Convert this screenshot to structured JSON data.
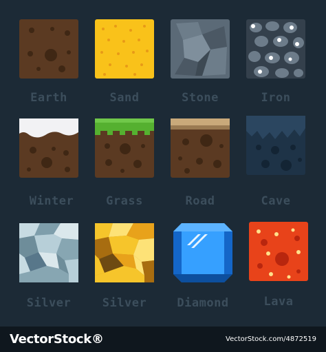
{
  "tiles": [
    {
      "label": "Earth"
    },
    {
      "label": "Sand"
    },
    {
      "label": "Stone"
    },
    {
      "label": "Iron"
    },
    {
      "label": "Winter"
    },
    {
      "label": "Grass"
    },
    {
      "label": "Road"
    },
    {
      "label": "Cave"
    },
    {
      "label": "Silver"
    },
    {
      "label": "Silver"
    },
    {
      "label": "Diamond"
    },
    {
      "label": "Lava"
    }
  ],
  "footer": {
    "brand": "VectorStock®",
    "url": "VectorStock.com/4872519"
  },
  "colors": {
    "background": "#1c2a36",
    "label": "#3c4e5c",
    "footer": "#0f171e"
  }
}
